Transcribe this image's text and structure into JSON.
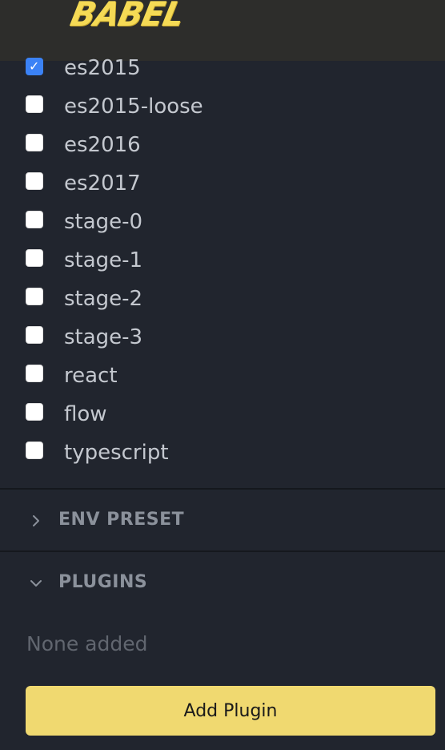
{
  "header": {
    "logo_text": "BABEL"
  },
  "presets": [
    {
      "label": "es2015",
      "checked": true
    },
    {
      "label": "es2015-loose",
      "checked": false
    },
    {
      "label": "es2016",
      "checked": false
    },
    {
      "label": "es2017",
      "checked": false
    },
    {
      "label": "stage-0",
      "checked": false
    },
    {
      "label": "stage-1",
      "checked": false
    },
    {
      "label": "stage-2",
      "checked": false
    },
    {
      "label": "stage-3",
      "checked": false
    },
    {
      "label": "react",
      "checked": false
    },
    {
      "label": "flow",
      "checked": false
    },
    {
      "label": "typescript",
      "checked": false
    }
  ],
  "env_preset": {
    "title": "ENV PRESET",
    "expanded": false,
    "icon": "chevron-right-icon"
  },
  "plugins": {
    "title": "PLUGINS",
    "expanded": true,
    "icon": "chevron-down-icon",
    "empty_text": "None added",
    "add_button_label": "Add Plugin"
  },
  "colors": {
    "background": "#21252e",
    "header": "#2d2d2b",
    "logo": "#f5da55",
    "checkbox_checked": "#3b82f6",
    "button": "#f0d970"
  }
}
